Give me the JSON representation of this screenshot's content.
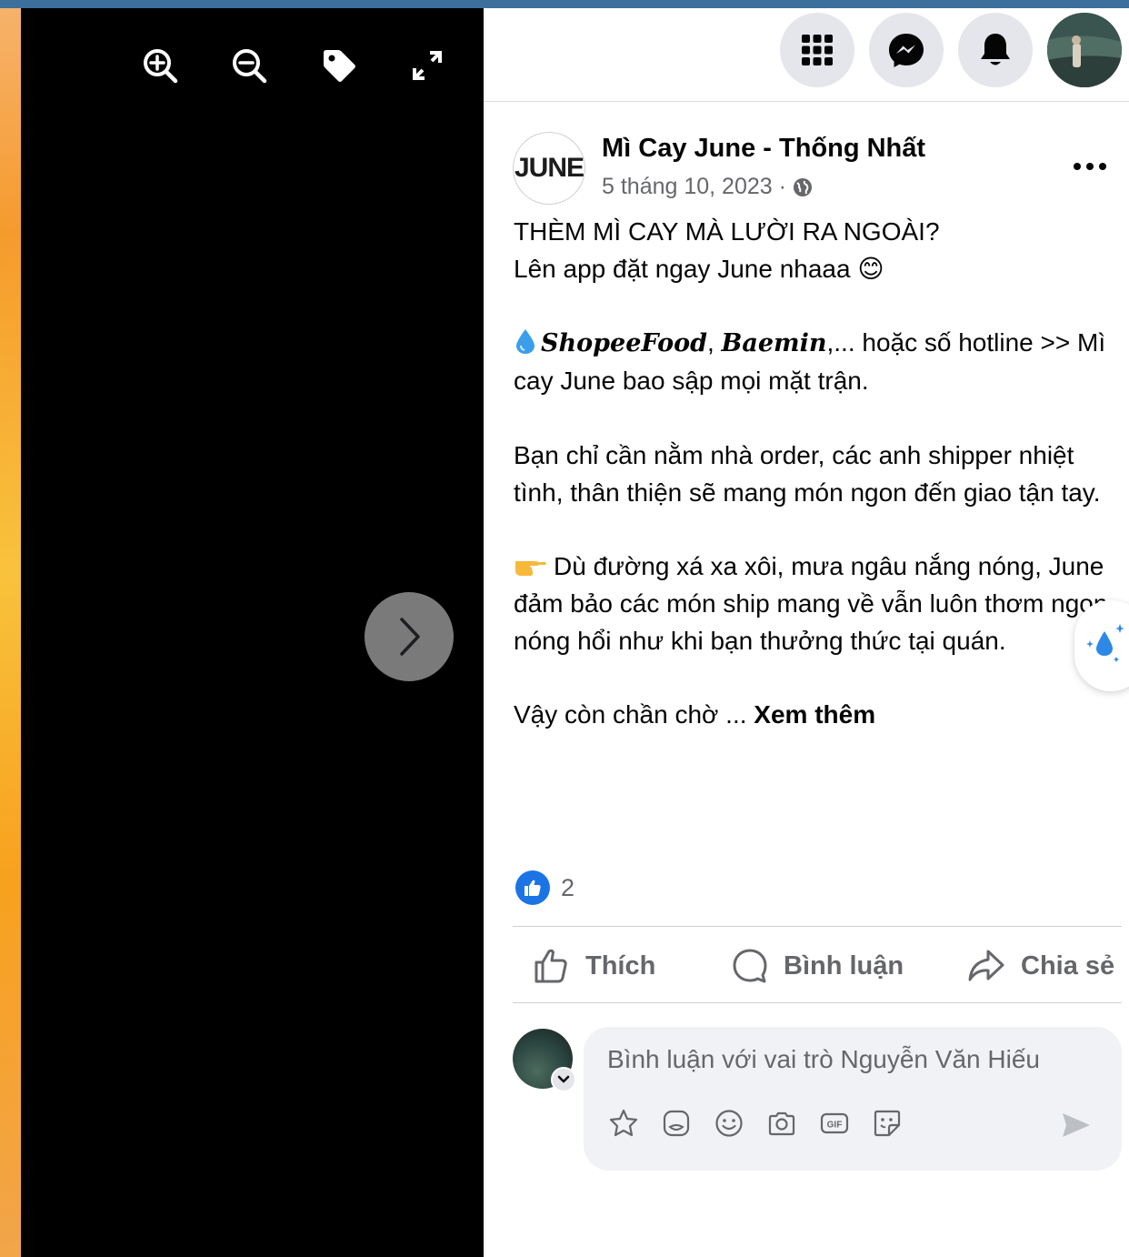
{
  "colors": {
    "top_strip": "#3d6f9b",
    "like_blue": "#1b74e4",
    "muted_text": "#65676b"
  },
  "viewer": {
    "tools": [
      {
        "icon": "zoom-in-icon"
      },
      {
        "icon": "zoom-out-icon"
      },
      {
        "icon": "tag-icon"
      },
      {
        "icon": "fullscreen-icon"
      }
    ],
    "next_icon": "chevron-right-icon"
  },
  "topbar": {
    "icons": [
      "menu-grid-icon",
      "messenger-icon",
      "notifications-bell-icon",
      "profile-avatar"
    ]
  },
  "post": {
    "logo_text": "JUNE",
    "page_name": "Mì Cay June - Thống Nhất",
    "date": "5 tháng 10, 2023 ·",
    "body": {
      "line1": "THÈM MÌ CAY MÀ LƯỜI RA NGOÀI?",
      "line2": "Lên app đặt ngay June nhaaa 😊",
      "p2_shopee": "ShopeeFood",
      "p2_comma": ",",
      "p2_baemin": "Baemin",
      "p2_rest": ",... hoặc số hotline >> Mì cay June bao sập mọi mặt trận.",
      "p3": "Bạn chỉ cần nằm nhà order, các anh shipper nhiệt tình, thân thiện sẽ mang món ngon đến giao tận tay.",
      "p4": "Dù đường xá xa xôi, mưa ngâu nắng nóng, June đảm bảo các món ship mang về vẫn luôn thơm ngon, nóng hổi như khi bạn thưởng thức tại quán.",
      "p5": "Vậy còn chần chờ ... ",
      "see_more": "Xem thêm"
    },
    "reaction_count": "2"
  },
  "actions": {
    "like": "Thích",
    "comment": "Bình luận",
    "share": "Chia sẻ"
  },
  "comment_box": {
    "placeholder": "Bình luận với vai trò Nguyễn Văn Hiếu",
    "tools": [
      "avatar-sticker-icon",
      "sticker-icon",
      "emoji-icon",
      "camera-icon",
      "gif-icon",
      "sticker-face-icon"
    ]
  }
}
